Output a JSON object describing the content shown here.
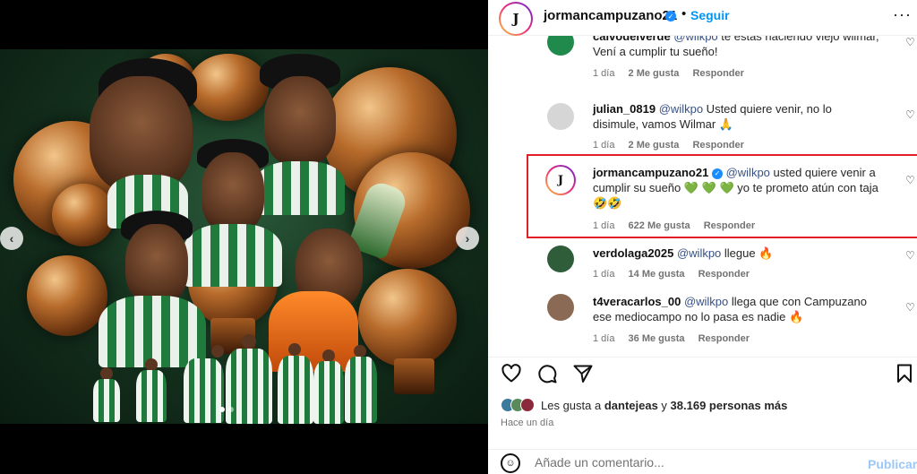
{
  "header": {
    "avatar_text": "J",
    "username": "jormancampuzano21",
    "dot": "•",
    "follow_label": "Seguir",
    "more": "···"
  },
  "carousel": {
    "prev": "‹",
    "next": "›",
    "dots": 2,
    "active_dot": 1
  },
  "comments": [
    {
      "username": "calvodelverde",
      "mention": "@wilkpo",
      "text": " te estas haciendo viejo wilmar, Vení a cumplir tu sueño!",
      "time": "1 día",
      "likes": "2 Me gusta",
      "reply": "Responder",
      "avatar_color": "#1f8a4c"
    },
    {
      "username": "julian_0819",
      "mention": "@wilkpo",
      "text": " Usted quiere venir, no lo disimule, vamos Wilmar 🙏",
      "time": "1 día",
      "likes": "2 Me gusta",
      "reply": "Responder",
      "avatar_color": "#c7c7c7"
    },
    {
      "username": "jormancampuzano21",
      "mention": "@wilkpo",
      "text": " usted quiere venir a cumplir su sueño 💚 💚 💚  yo te prometo atún con taja 🤣🤣",
      "time": "1 día",
      "likes": "622 Me gusta",
      "reply": "Responder",
      "avatar_color": "#ffffff"
    },
    {
      "username": "verdolaga2025",
      "mention": "@wilkpo",
      "text": " llegue 🔥",
      "time": "1 día",
      "likes": "14 Me gusta",
      "reply": "Responder",
      "avatar_color": "#2f5d3a"
    },
    {
      "username": "t4veracarlos_00",
      "mention": "@wilkpo",
      "text": " llega que con Campuzano ese mediocampo no lo pasa es nadie 🔥",
      "time": "1 día",
      "likes": "36 Me gusta",
      "reply": "Responder",
      "avatar_color": "#8a6a55"
    }
  ],
  "actions": {
    "like_icon": "heart-icon",
    "comment_icon": "comment-icon",
    "share_icon": "share-icon",
    "save_icon": "bookmark-icon"
  },
  "likes": {
    "prefix": "Les gusta a ",
    "user": "dantejeas",
    "middle": " y ",
    "count": "38.169 personas más"
  },
  "time_ago": "Hace un día",
  "composer": {
    "placeholder": "Añade un comentario...",
    "publish_label": "Publicar"
  },
  "colors": {
    "accent": "#0095f6",
    "highlight": "#e21f26",
    "mention": "#385185"
  }
}
